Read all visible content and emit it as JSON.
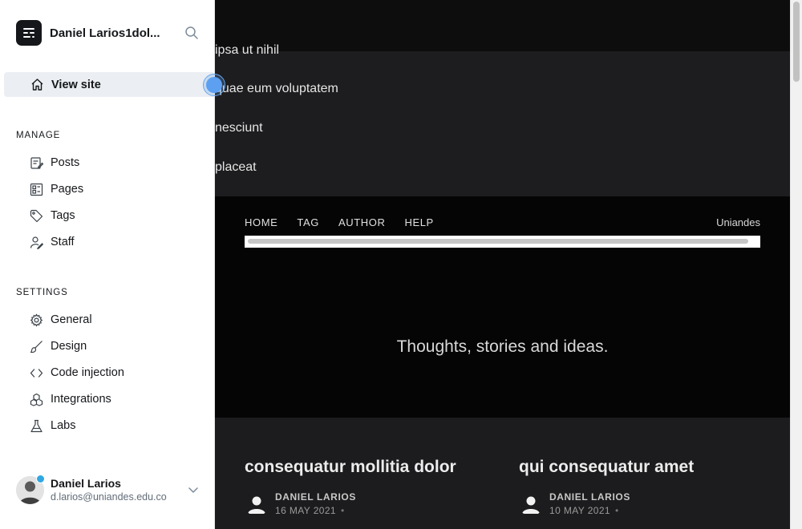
{
  "site_preview": {
    "menu_items": [
      "ipsa ut nihil",
      "quae eum voluptatem",
      "nesciunt",
      "placeat"
    ],
    "nav": [
      "HOME",
      "TAG",
      "AUTHOR",
      "HELP"
    ],
    "brand": "Uniandes",
    "tagline": "Thoughts, stories and ideas.",
    "posts": [
      {
        "title": "consequatur mollitia dolor",
        "author": "DANIEL LARIOS",
        "date": "16 MAY 2021",
        "separator": "•"
      },
      {
        "title": "qui consequatur amet",
        "author": "DANIEL LARIOS",
        "date": "10 MAY 2021",
        "separator": "•"
      }
    ]
  },
  "sidebar": {
    "site_name": "Daniel Larios1dol...",
    "view_site": "View site",
    "manage_label": "MANAGE",
    "manage_items": [
      "Posts",
      "Pages",
      "Tags",
      "Staff"
    ],
    "settings_label": "SETTINGS",
    "settings_items": [
      "General",
      "Design",
      "Code injection",
      "Integrations",
      "Labs"
    ],
    "user": {
      "name": "Daniel Larios",
      "email": "d.larios@uniandes.edu.co"
    }
  },
  "colors": {
    "accent": "#5d9ff0",
    "notification_dot": "#30a7e3",
    "active_bg": "#ebeef2"
  }
}
